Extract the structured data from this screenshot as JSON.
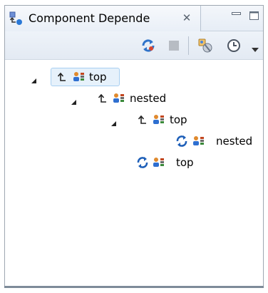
{
  "tab": {
    "title": "Component Depende",
    "close_glyph": "✕",
    "icon": "component-dependencies-icon"
  },
  "window_controls": [
    "minimize-icon",
    "maximize-icon"
  ],
  "toolbar": {
    "buttons": [
      "refresh-icon",
      "stop-icon",
      "scope-icon",
      "history-icon",
      "view-menu-dropdown-icon"
    ]
  },
  "tree": {
    "selected": 0,
    "nodes": [
      {
        "label": "top",
        "depth": 0,
        "expanded": true,
        "kind": "dependency"
      },
      {
        "label": "nested",
        "depth": 1,
        "expanded": true,
        "kind": "dependency"
      },
      {
        "label": "top",
        "depth": 2,
        "expanded": true,
        "kind": "dependency"
      },
      {
        "label": "nested",
        "depth": 3,
        "expanded": false,
        "kind": "cycle"
      },
      {
        "label": "top",
        "depth": 2,
        "expanded": false,
        "kind": "cycle"
      }
    ]
  },
  "colors": {
    "selection_bg": "#e6f1fb",
    "selection_border": "#a8cff1",
    "cycle_icon": "#1e5fb8"
  }
}
